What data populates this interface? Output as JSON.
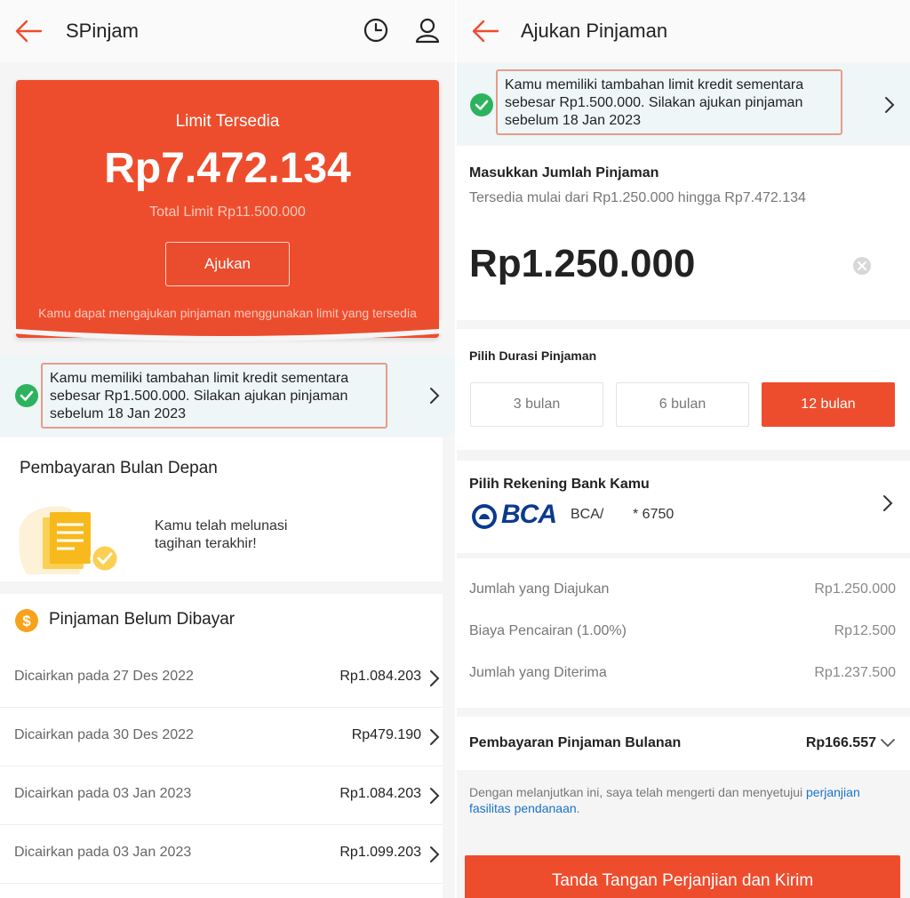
{
  "colors": {
    "accent": "#ee4d2d",
    "success": "#2db35d",
    "link": "#1a73c7",
    "coin": "#f7a21b"
  },
  "left": {
    "header": {
      "title": "SPinjam",
      "back_icon": "arrow-left-icon",
      "history_icon": "clock-icon",
      "profile_icon": "user-icon"
    },
    "hero": {
      "label": "Limit Tersedia",
      "amount": "Rp7.472.134",
      "total": "Total Limit Rp11.500.000",
      "button": "Ajukan",
      "note": "Kamu dapat mengajukan pinjaman menggunakan limit yang tersedia"
    },
    "banner": {
      "text": "Kamu memiliki tambahan limit kredit sementara sebesar Rp1.500.000. Silakan ajukan pinjaman sebelum 18 Jan 2023"
    },
    "next_payment": {
      "title": "Pembayaran Bulan Depan",
      "message": "Kamu telah melunasi tagihan terakhir!"
    },
    "unpaid": {
      "title": "Pinjaman Belum Dibayar",
      "loans": [
        {
          "date": "Dicairkan pada 27 Des 2022",
          "amount": "Rp1.084.203"
        },
        {
          "date": "Dicairkan pada 30 Des 2022",
          "amount": "Rp479.190"
        },
        {
          "date": "Dicairkan pada 03 Jan 2023",
          "amount": "Rp1.084.203"
        },
        {
          "date": "Dicairkan pada 03 Jan 2023",
          "amount": "Rp1.099.203"
        }
      ]
    }
  },
  "right": {
    "header": {
      "title": "Ajukan Pinjaman"
    },
    "banner": {
      "text": "Kamu memiliki tambahan limit kredit sementara sebesar Rp1.500.000. Silakan ajukan pinjaman sebelum 18 Jan 2023"
    },
    "amount_section": {
      "title": "Masukkan Jumlah Pinjaman",
      "range": "Tersedia mulai dari Rp1.250.000 hingga Rp7.472.134",
      "value": "Rp1.250.000"
    },
    "duration": {
      "title": "Pilih Durasi Pinjaman",
      "options": [
        "3 bulan",
        "6 bulan",
        "12 bulan"
      ],
      "selected": "12 bulan"
    },
    "bank": {
      "title": "Pilih Rekening Bank Kamu",
      "logo_text": "BCA",
      "name": "BCA/",
      "account": "* 6750"
    },
    "summary": [
      {
        "label": "Jumlah yang Diajukan",
        "value": "Rp1.250.000"
      },
      {
        "label": "Biaya Pencairan (1.00%)",
        "value": "Rp12.500"
      },
      {
        "label": "Jumlah yang Diterima",
        "value": "Rp1.237.500"
      }
    ],
    "monthly": {
      "label": "Pembayaran Pinjaman Bulanan",
      "value": "Rp166.557"
    },
    "terms": {
      "text": "Dengan melanjutkan ini, saya telah mengerti dan menyetujui ",
      "link": "perjanjian fasilitas pendanaan",
      "suffix": "."
    },
    "submit": "Tanda Tangan Perjanjian dan Kirim"
  }
}
